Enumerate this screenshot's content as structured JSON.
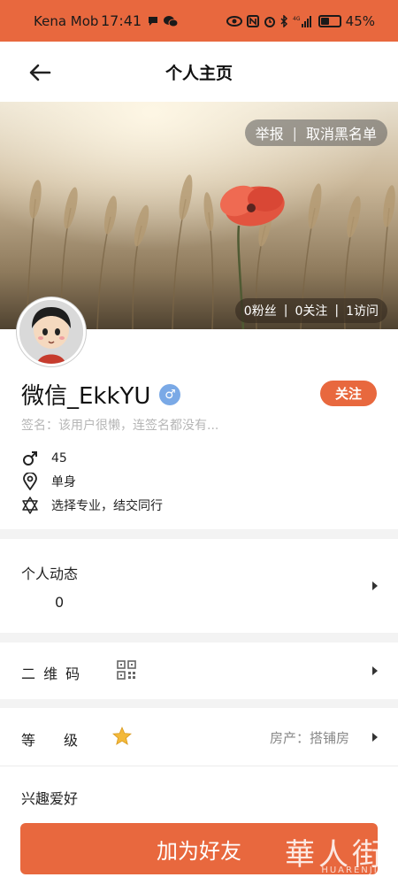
{
  "status_bar": {
    "carrier": "Kena Mob",
    "time": "17:41",
    "battery": "45%",
    "battery_level": 0.45,
    "network": "4G"
  },
  "header": {
    "title": "个人主页",
    "back_icon": "arrow-left-icon"
  },
  "cover": {
    "report_label": "举报",
    "unblock_label": "取消黑名单",
    "separator": "|",
    "followers": "0粉丝",
    "following": "0关注",
    "visits": "1访问"
  },
  "profile": {
    "name": "微信_EkkYU",
    "gender_symbol": "♂",
    "follow_label": "关注",
    "signature": "签名：该用户很懒，连签名都没有...",
    "age": "45",
    "relationship": "单身",
    "major": "选择专业，结交同行"
  },
  "sections": {
    "moments_label": "个人动态",
    "moments_count": "0",
    "qrcode_label": "二 维 码",
    "level_label": "等　　级",
    "house_label": "房产：搭铺房",
    "hobbies_label": "兴趣爱好"
  },
  "footer": {
    "add_friend_label": "加为好友",
    "watermark": "華人街",
    "watermark_sub": "HUARENJIE"
  },
  "colors": {
    "accent": "#e8683e",
    "gender_blue": "#7aa9e6",
    "star_gold": "#f3b93a"
  }
}
